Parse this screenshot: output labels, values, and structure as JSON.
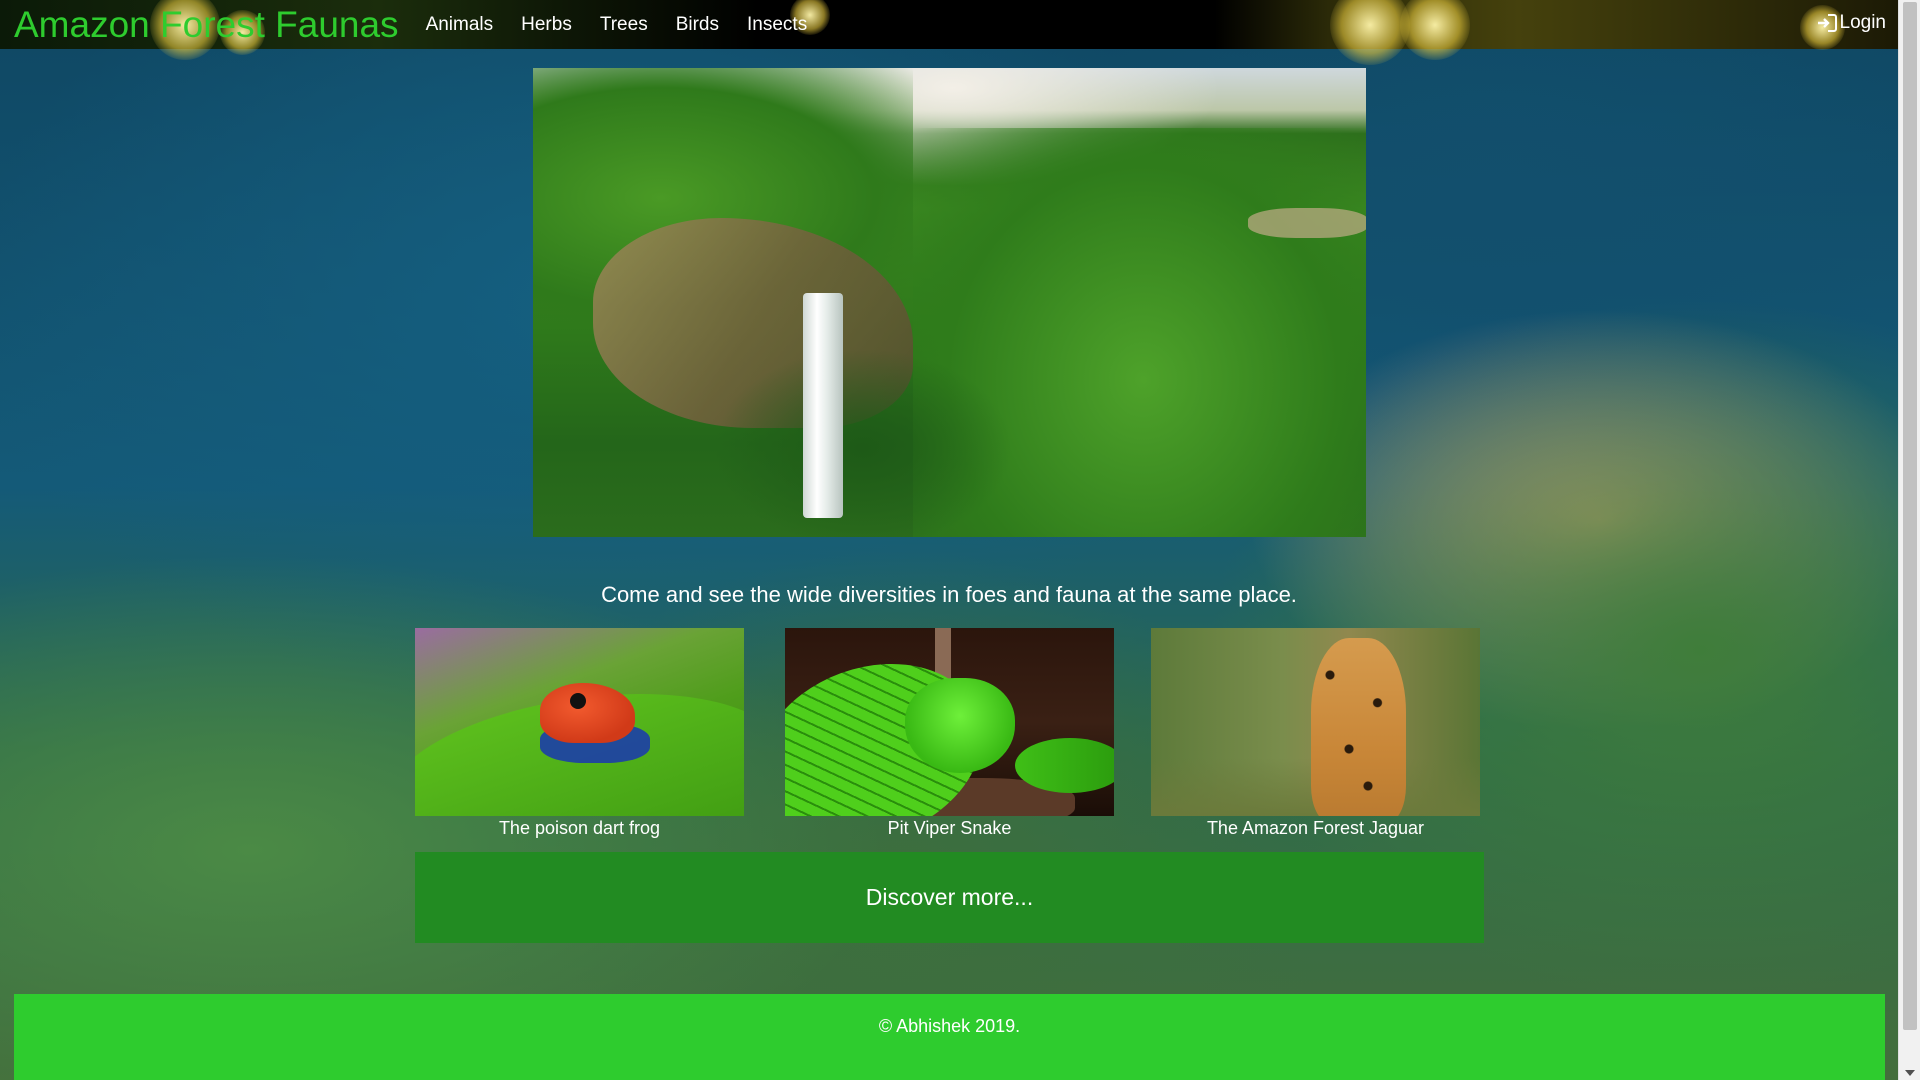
{
  "brand": "Amazon Forest Faunas",
  "nav": {
    "items": [
      {
        "label": "Animals"
      },
      {
        "label": "Herbs"
      },
      {
        "label": "Trees"
      },
      {
        "label": "Birds"
      },
      {
        "label": "Insects"
      }
    ],
    "login_label": "Login"
  },
  "tagline": "Come and see the wide diversities in foes and fauna at the same place.",
  "cards": [
    {
      "caption": "The poison dart frog"
    },
    {
      "caption": "Pit Viper Snake"
    },
    {
      "caption": "The Amazon Forest Jaguar"
    }
  ],
  "discover_label": "Discover more...",
  "footer": {
    "copyright": "© Abhishek 2019."
  },
  "colors": {
    "brand": "#2ecc2e",
    "discover_bg": "#228b22",
    "footer_bg": "#2ecc2e",
    "navbar_bg": "#000000"
  },
  "icons": {
    "login": "sign-in-icon"
  }
}
